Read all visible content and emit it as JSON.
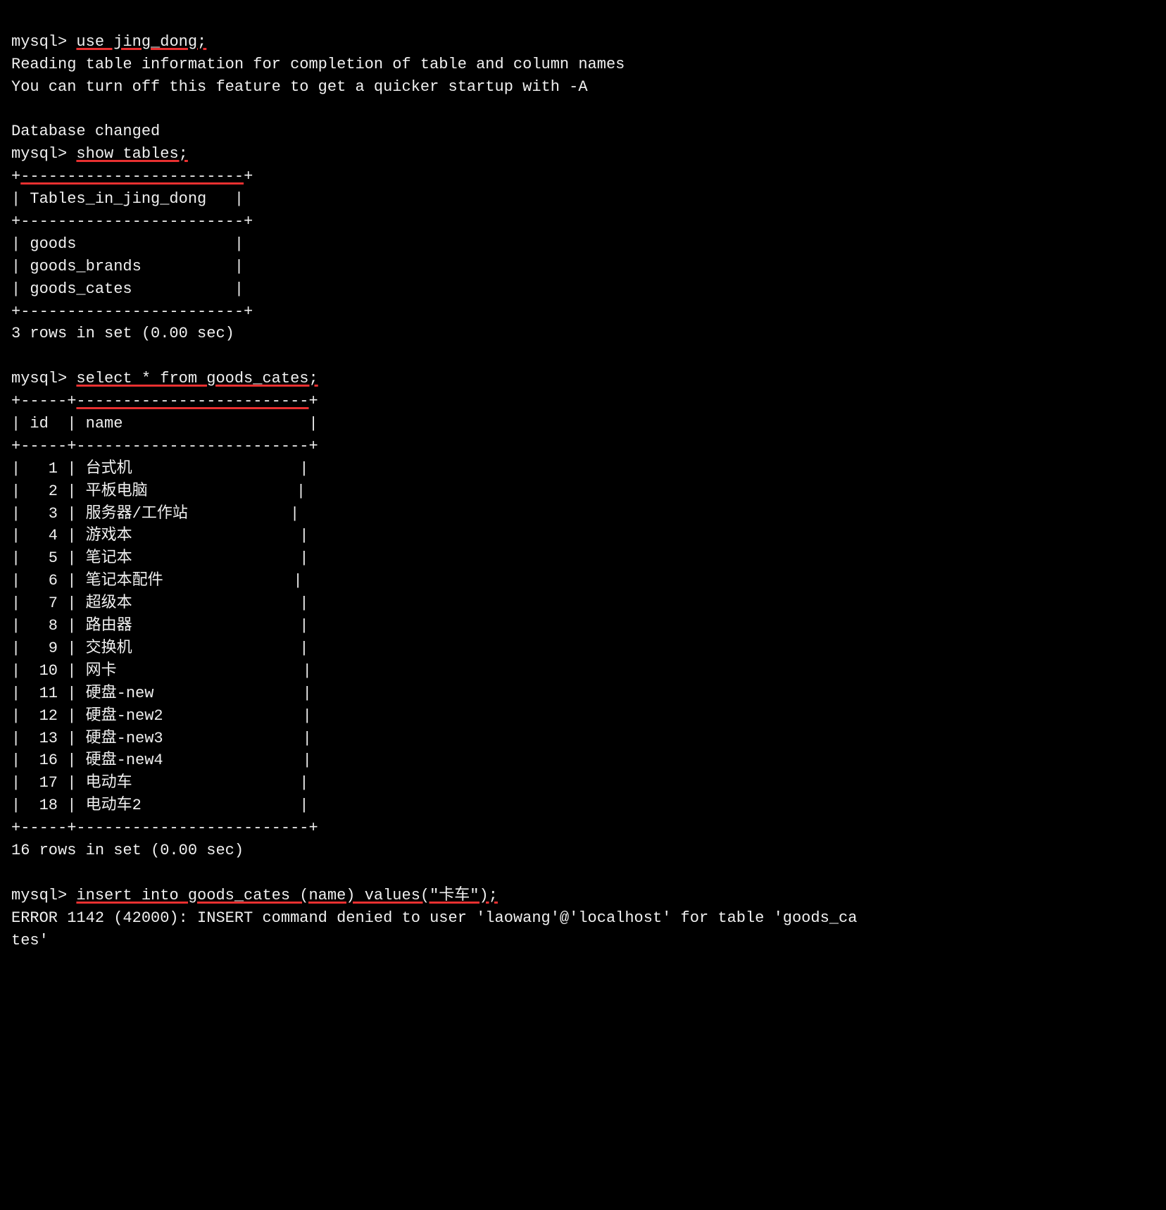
{
  "terminal": {
    "lines": [
      {
        "type": "prompt-cmd",
        "prompt": "mysql> ",
        "cmd": "use jing_dong;",
        "highlight": true
      },
      {
        "type": "info",
        "text": "Reading table information for completion of table and column names"
      },
      {
        "type": "info",
        "text": "You can turn off this feature to get a quicker startup with -A"
      },
      {
        "type": "blank"
      },
      {
        "type": "info",
        "text": "Database changed"
      },
      {
        "type": "prompt-cmd",
        "prompt": "mysql> ",
        "cmd": "show tables;",
        "highlight": true
      },
      {
        "type": "table-border",
        "text": "+------------------------+"
      },
      {
        "type": "table-row",
        "text": "| Tables_in_jing_dong   |"
      },
      {
        "type": "table-border",
        "text": "+------------------------+"
      },
      {
        "type": "table-row",
        "text": "| goods                 |"
      },
      {
        "type": "table-row",
        "text": "| goods_brands          |"
      },
      {
        "type": "table-row",
        "text": "| goods_cates           |"
      },
      {
        "type": "table-border",
        "text": "+------------------------+"
      },
      {
        "type": "info",
        "text": "3 rows in set (0.00 sec)"
      },
      {
        "type": "blank"
      },
      {
        "type": "prompt-cmd",
        "prompt": "mysql> ",
        "cmd": "select * from goods_cates;",
        "highlight": true
      },
      {
        "type": "table-border2",
        "text": "+-----+-------------------------+"
      },
      {
        "type": "table-row",
        "text": "| id  | name                    |"
      },
      {
        "type": "table-border2",
        "text": "+-----+-------------------------+"
      },
      {
        "type": "table-row",
        "text": "|   1 | 台式机                  |"
      },
      {
        "type": "table-row",
        "text": "|   2 | 平板电脑                |"
      },
      {
        "type": "table-row",
        "text": "|   3 | 服务器/工作站           |"
      },
      {
        "type": "table-row",
        "text": "|   4 | 游戏本                  |"
      },
      {
        "type": "table-row",
        "text": "|   5 | 笔记本                  |"
      },
      {
        "type": "table-row",
        "text": "|   6 | 笔记本配件              |"
      },
      {
        "type": "table-row",
        "text": "|   7 | 超级本                  |"
      },
      {
        "type": "table-row",
        "text": "|   8 | 路由器                  |"
      },
      {
        "type": "table-row",
        "text": "|   9 | 交换机                  |"
      },
      {
        "type": "table-row",
        "text": "|  10 | 网卡                    |"
      },
      {
        "type": "table-row",
        "text": "|  11 | 硬盘-new                |"
      },
      {
        "type": "table-row",
        "text": "|  12 | 硬盘-new2               |"
      },
      {
        "type": "table-row",
        "text": "|  13 | 硬盘-new3               |"
      },
      {
        "type": "table-row",
        "text": "|  16 | 硬盘-new4               |"
      },
      {
        "type": "table-row",
        "text": "|  17 | 电动车                  |"
      },
      {
        "type": "table-row",
        "text": "|  18 | 电动车2                 |"
      },
      {
        "type": "table-border2",
        "text": "+-----+-------------------------+"
      },
      {
        "type": "info",
        "text": "16 rows in set (0.00 sec)"
      },
      {
        "type": "blank"
      },
      {
        "type": "prompt-cmd",
        "prompt": "mysql> ",
        "cmd": "insert into goods_cates (name) values(\"卡车\");",
        "highlight": true
      },
      {
        "type": "error",
        "text": "ERROR 1142 (42000): INSERT command denied to user 'laowang'@'localhost' for table 'goods_ca"
      },
      {
        "type": "error-cont",
        "text": "tes'"
      }
    ]
  }
}
